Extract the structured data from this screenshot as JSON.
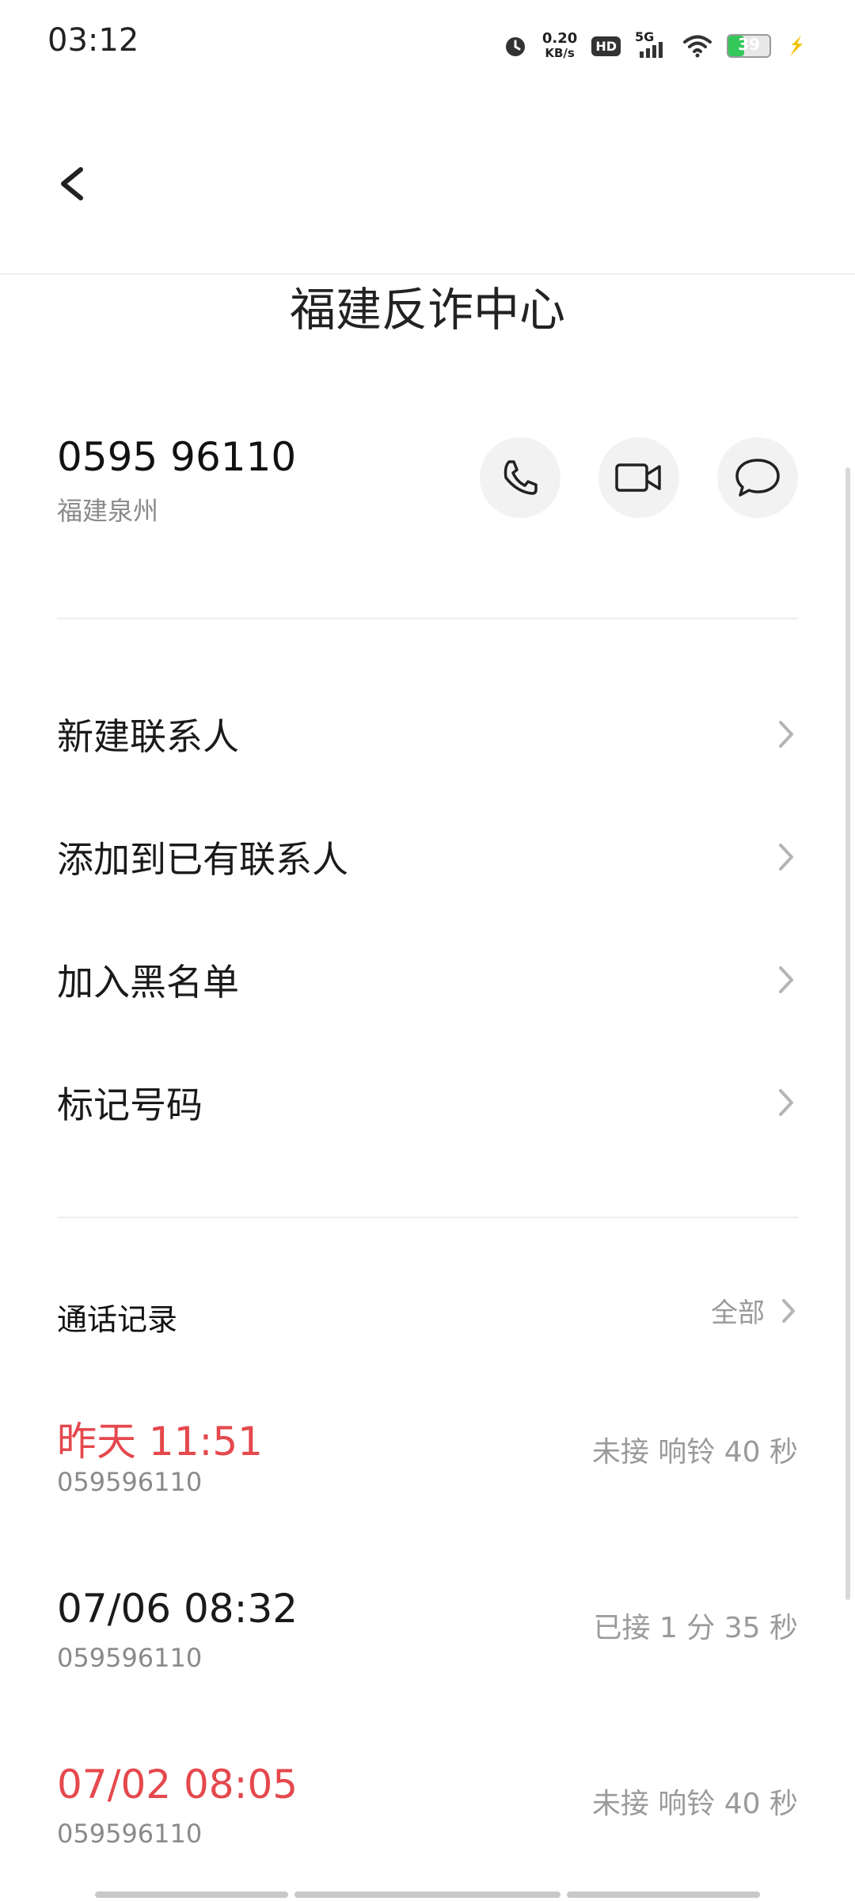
{
  "status_bar": {
    "time": "03:12",
    "net_speed_value": "0.20",
    "net_speed_unit": "KB/s",
    "hd": "HD",
    "network": "5G",
    "battery": "39",
    "battery_level": 0.39
  },
  "contact": {
    "name": "福建反诈中心",
    "number": "0595 96110",
    "location": "福建泉州"
  },
  "menu": [
    {
      "label": "新建联系人"
    },
    {
      "label": "添加到已有联系人"
    },
    {
      "label": "加入黑名单"
    },
    {
      "label": "标记号码"
    }
  ],
  "call_log": {
    "title": "通话记录",
    "view_all": "全部",
    "entries": [
      {
        "time": "昨天 11:51",
        "number": "059596110",
        "status": "未接 响铃 40 秒",
        "missed": true
      },
      {
        "time": "07/06 08:32",
        "number": "059596110",
        "status": "已接 1 分 35 秒",
        "missed": false
      },
      {
        "time": "07/02 08:05",
        "number": "059596110",
        "status": "未接 响铃 40 秒",
        "missed": true
      }
    ]
  },
  "colors": {
    "missed": "#e5484d",
    "secondary_text": "#8a8a8a",
    "button_bg": "#f2f2f2"
  },
  "icons": [
    "back-arrow-icon",
    "phone-icon",
    "video-icon",
    "message-icon",
    "chevron-right-icon",
    "alarm-icon",
    "wifi-icon",
    "signal-icon",
    "battery-icon",
    "charging-icon"
  ]
}
